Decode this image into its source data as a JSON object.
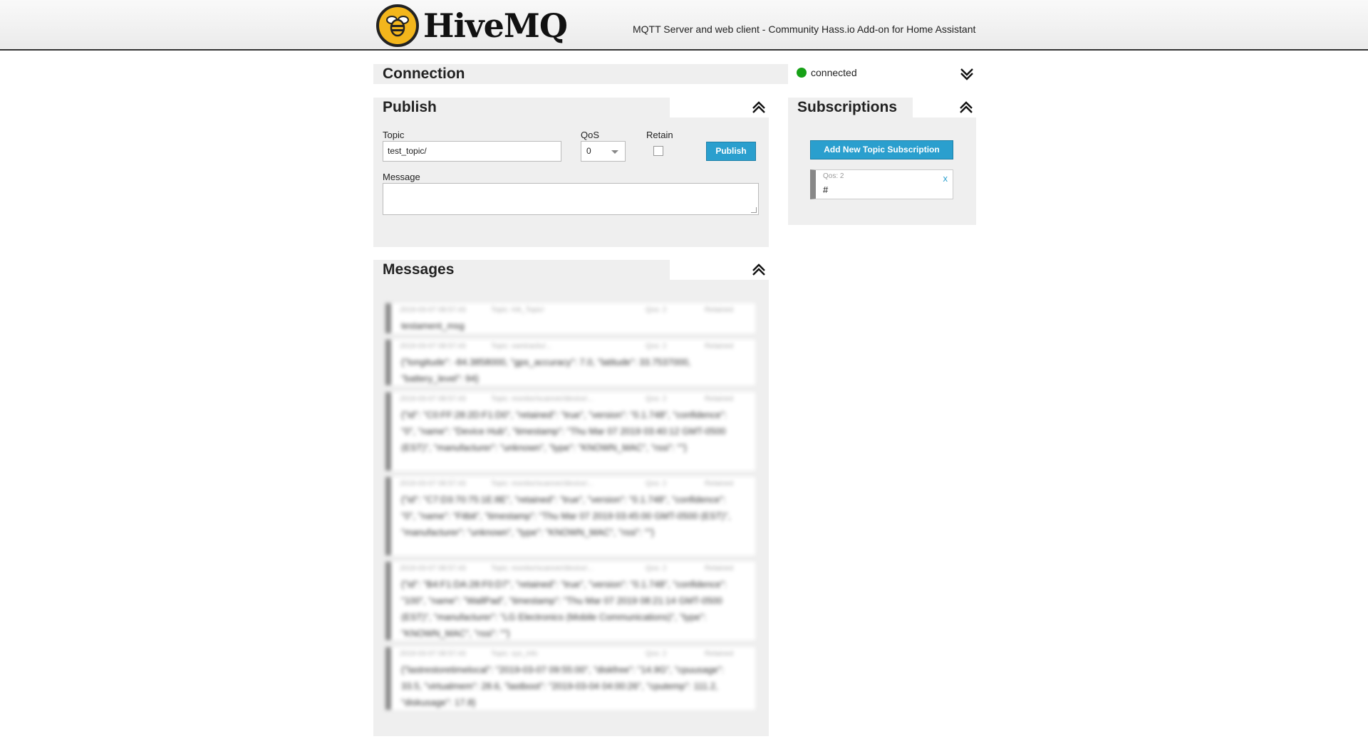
{
  "header": {
    "logo_text": "HiveMQ",
    "subtitle": "MQTT Server and web client - Community Hass.io Add-on for Home Assistant"
  },
  "connection": {
    "title": "Connection",
    "status": "connected",
    "status_color": "#17a117"
  },
  "publish": {
    "title": "Publish",
    "topic_label": "Topic",
    "topic_value": "test_topic/",
    "qos_label": "QoS",
    "qos_value": "0",
    "retain_label": "Retain",
    "button_label": "Publish",
    "message_label": "Message"
  },
  "subscriptions": {
    "title": "Subscriptions",
    "add_button": "Add New Topic Subscription",
    "items": [
      {
        "qos": "Qos: 2",
        "topic": "#",
        "close": "x"
      }
    ]
  },
  "messages": {
    "title": "Messages",
    "items": [
      {
        "time": "2019-03-07 08:57:43",
        "topic": "Topic: HA_Topic/",
        "qos": "Qos: 2",
        "retained": "Retained",
        "body": "testament_msg"
      },
      {
        "time": "2019-03-07 08:57:43",
        "topic": "Topic: owntracks/...",
        "qos": "Qos: 2",
        "retained": "Retained",
        "body": "{\"longitude\": -84.3858000, \"gps_accuracy\": 7.0, \"latitude\": 33.7537000, \"battery_level\": 94}"
      },
      {
        "time": "2019-03-07 08:57:43",
        "topic": "Topic: monitor/scanner/device/...",
        "qos": "Qos: 2",
        "retained": "Retained",
        "body": "{\"id\": \"C0:FF:28:2D:F1:D0\", \"retained\": \"true\", \"version\": \"0.1.748\", \"confidence\": \"0\", \"name\": \"Device Hub\", \"timestamp\": \"Thu Mar 07 2019 03:40:12 GMT-0500 (EST)\", \"manufacturer\": \"unknown\", \"type\": \"KNOWN_MAC\", \"rssi\": \"\"}"
      },
      {
        "time": "2019-03-07 08:57:43",
        "topic": "Topic: monitor/scanner/device/...",
        "qos": "Qos: 2",
        "retained": "Retained",
        "body": "{\"id\": \"C7:D3:70:75:1E:8E\", \"retained\": \"true\", \"version\": \"0.1.748\", \"confidence\": \"0\", \"name\": \"Fitbit\", \"timestamp\": \"Thu Mar 07 2019 03:45:00 GMT-0500 (EST)\", \"manufacturer\": \"unknown\", \"type\": \"KNOWN_MAC\", \"rssi\": \"\"}"
      },
      {
        "time": "2019-03-07 08:57:43",
        "topic": "Topic: monitor/scanner/device/...",
        "qos": "Qos: 2",
        "retained": "Retained",
        "body": "{\"id\": \"B4:F1:DA:28:F0:D7\", \"retained\": \"true\", \"version\": \"0.1.748\", \"confidence\": \"100\", \"name\": \"WallPad\", \"timestamp\": \"Thu Mar 07 2019 08:21:14 GMT-0500 (EST)\", \"manufacturer\": \"LG Electronics (Mobile Communications)\", \"type\": \"KNOWN_MAC\", \"rssi\": \"\"}"
      },
      {
        "time": "2019-03-07 08:57:43",
        "topic": "Topic: sys_info",
        "qos": "Qos: 2",
        "retained": "Retained",
        "body": "{\"lastrestoretimelocal\": \"2019-03-07 09:55:00\", \"diskfree\": \"14.9G\", \"cpuusage\": 33.5, \"virtualmem\": 28.6, \"lastboot\": \"2019-03-04 04:00:26\", \"cputemp\": 111.2, \"diskusage\": 17.8}"
      }
    ]
  }
}
